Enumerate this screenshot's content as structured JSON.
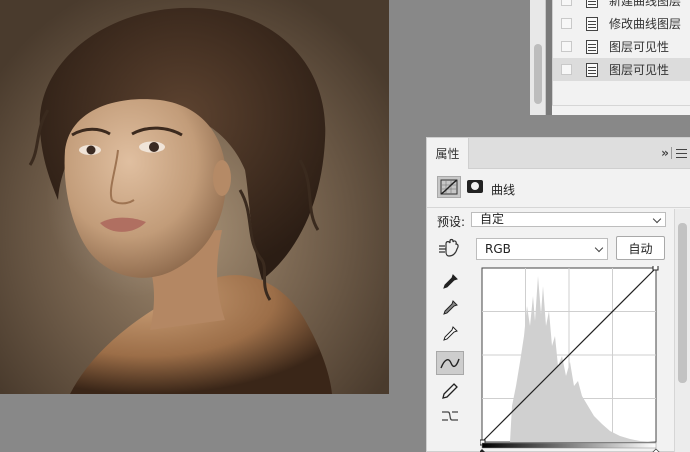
{
  "history": {
    "items": [
      {
        "label": "新建曲线图层",
        "active": false
      },
      {
        "label": "修改曲线图层",
        "active": false
      },
      {
        "label": "图层可见性",
        "active": false
      },
      {
        "label": "图层可见性",
        "active": true
      }
    ]
  },
  "properties": {
    "tab_label": "属性",
    "adjustment_name": "曲线",
    "preset_label": "预设:",
    "preset_value": "自定",
    "channel_value": "RGB",
    "auto_button": "自动",
    "tools": [
      "hand-target-icon",
      "black-point-eyedropper-icon",
      "gray-point-eyedropper-icon",
      "white-point-eyedropper-icon",
      "curve-edit-icon",
      "pencil-icon",
      "smooth-curve-icon"
    ],
    "curve_points": [
      [
        0,
        0
      ],
      [
        255,
        255
      ]
    ]
  },
  "colors": {
    "workspace": "#888888",
    "panel_bg": "#f2f2f2",
    "histogram": "#d0d0d0",
    "curve": "#222222"
  }
}
